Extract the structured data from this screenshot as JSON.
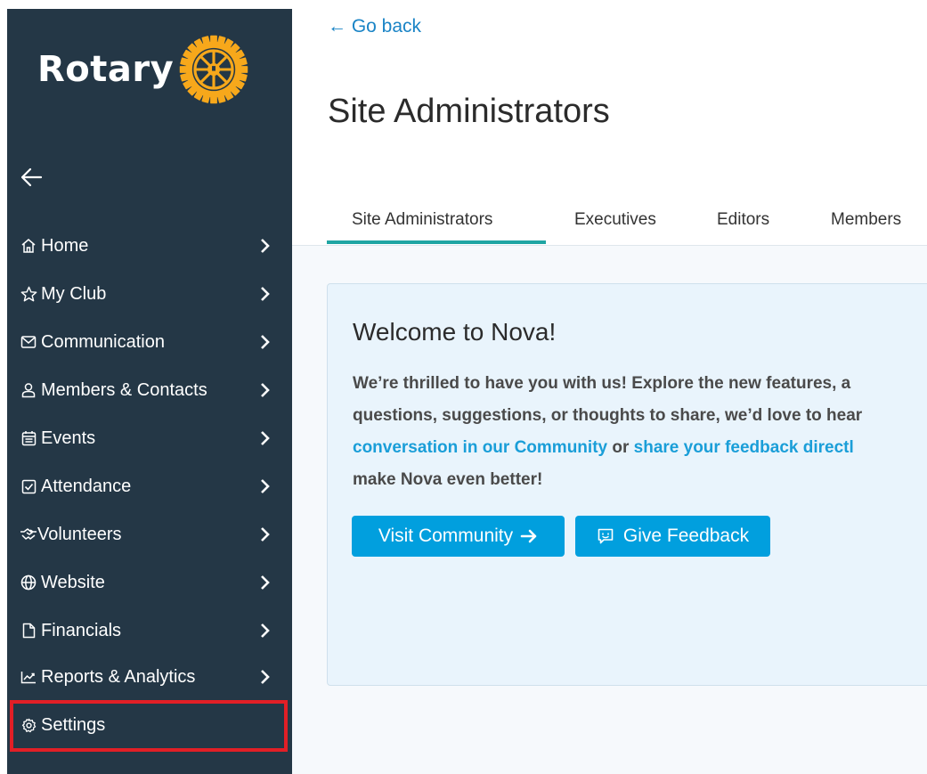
{
  "brand": {
    "logo_text": "Rotary",
    "accent": "#f7a81b",
    "sidebar_bg": "#243746"
  },
  "sidebar": {
    "items": [
      {
        "label": "Home",
        "icon": "home-icon",
        "has_chevron": true
      },
      {
        "label": "My Club",
        "icon": "star-icon",
        "has_chevron": true
      },
      {
        "label": "Communication",
        "icon": "mail-icon",
        "has_chevron": true
      },
      {
        "label": "Members & Contacts",
        "icon": "user-icon",
        "has_chevron": true
      },
      {
        "label": "Events",
        "icon": "calendar-icon",
        "has_chevron": true
      },
      {
        "label": "Attendance",
        "icon": "checkbox-icon",
        "has_chevron": true
      },
      {
        "label": "Volunteers",
        "icon": "handshake-icon",
        "has_chevron": true
      },
      {
        "label": "Website",
        "icon": "globe-icon",
        "has_chevron": true
      },
      {
        "label": "Financials",
        "icon": "file-icon",
        "has_chevron": true
      },
      {
        "label": "Reports & Analytics",
        "icon": "chart-icon",
        "has_chevron": true
      },
      {
        "label": "Settings",
        "icon": "gear-icon",
        "has_chevron": false
      }
    ]
  },
  "header": {
    "back_label": "← Go back",
    "title": "Site Administrators"
  },
  "tabs": [
    {
      "label": "Site Administrators",
      "active": true
    },
    {
      "label": "Executives",
      "active": false
    },
    {
      "label": "Editors",
      "active": false
    },
    {
      "label": "Members",
      "active": false
    }
  ],
  "welcome": {
    "title": "Welcome to Nova!",
    "line1": "We’re thrilled to have you with us! Explore the new features, a",
    "line2": "questions, suggestions, or thoughts to share, we’d love to hear",
    "link1": "conversation in our Community",
    "connector": " or ",
    "link2": "share your feedback directl",
    "line4": "make Nova even better!",
    "visit_label": "Visit Community",
    "feedback_label": "Give Feedback"
  }
}
